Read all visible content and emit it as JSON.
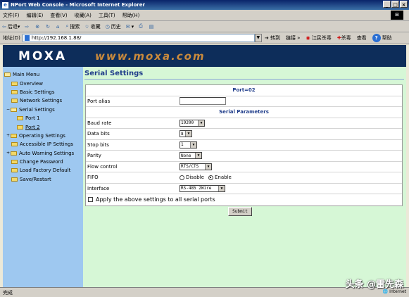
{
  "window": {
    "title": "NPort Web Console - Microsoft Internet Explorer",
    "controls": [
      "_",
      "□",
      "×"
    ]
  },
  "menubar": {
    "items": [
      "文件(F)",
      "编辑(E)",
      "查看(V)",
      "收藏(A)",
      "工具(T)",
      "帮助(H)"
    ]
  },
  "toolbar": {
    "back": "后退",
    "search": "搜索",
    "favorites": "收藏",
    "history": "历史"
  },
  "addressbar": {
    "label": "地址(D)",
    "url": "http://192.168.1.88/",
    "go": "转到",
    "links": "链接 »",
    "ext1": "江民杀毒",
    "ext2": "杀毒",
    "ext3": "查看",
    "help": "帮助"
  },
  "banner": {
    "logo": "MOXA",
    "url": "www.moxa.com"
  },
  "sidebar": {
    "items": [
      {
        "label": "Main Menu",
        "expander": "",
        "indent": 0
      },
      {
        "label": "Overview",
        "expander": "",
        "indent": 1
      },
      {
        "label": "Basic Settings",
        "expander": "",
        "indent": 1
      },
      {
        "label": "Network Settings",
        "expander": "",
        "indent": 1
      },
      {
        "label": "Serial Settings",
        "expander": "−",
        "indent": 1
      },
      {
        "label": "Port 1",
        "expander": "",
        "indent": 2
      },
      {
        "label": "Port 2",
        "expander": "",
        "indent": 2
      },
      {
        "label": "Operating Settings",
        "expander": "+",
        "indent": 1
      },
      {
        "label": "Accessible IP Settings",
        "expander": "",
        "indent": 1
      },
      {
        "label": "Auto Warning Settings",
        "expander": "+",
        "indent": 1
      },
      {
        "label": "Change Password",
        "expander": "",
        "indent": 1
      },
      {
        "label": "Load Factory Default",
        "expander": "",
        "indent": 1
      },
      {
        "label": "Save/Restart",
        "expander": "",
        "indent": 1
      }
    ]
  },
  "main": {
    "title": "Serial Settings",
    "port_header": "Port=02",
    "port_alias_label": "Port alias",
    "port_alias_value": "",
    "serial_params_header": "Serial Parameters",
    "baud_rate": {
      "label": "Baud rate",
      "value": "19200"
    },
    "data_bits": {
      "label": "Data bits",
      "value": "8"
    },
    "stop_bits": {
      "label": "Stop bits",
      "value": "1"
    },
    "parity": {
      "label": "Parity",
      "value": "None"
    },
    "flow_control": {
      "label": "Flow control",
      "value": "RTS/CTS"
    },
    "fifo": {
      "label": "FIFO",
      "disable": "Disable",
      "enable": "Enable",
      "selected": "Enable"
    },
    "interface": {
      "label": "Interface",
      "value": "RS-485 2Wire"
    },
    "apply_all": "Apply the above settings to all serial ports",
    "submit": "Submit"
  },
  "statusbar": {
    "status": "完成",
    "zone": "Internet"
  },
  "watermark": "头条 @雷先森"
}
